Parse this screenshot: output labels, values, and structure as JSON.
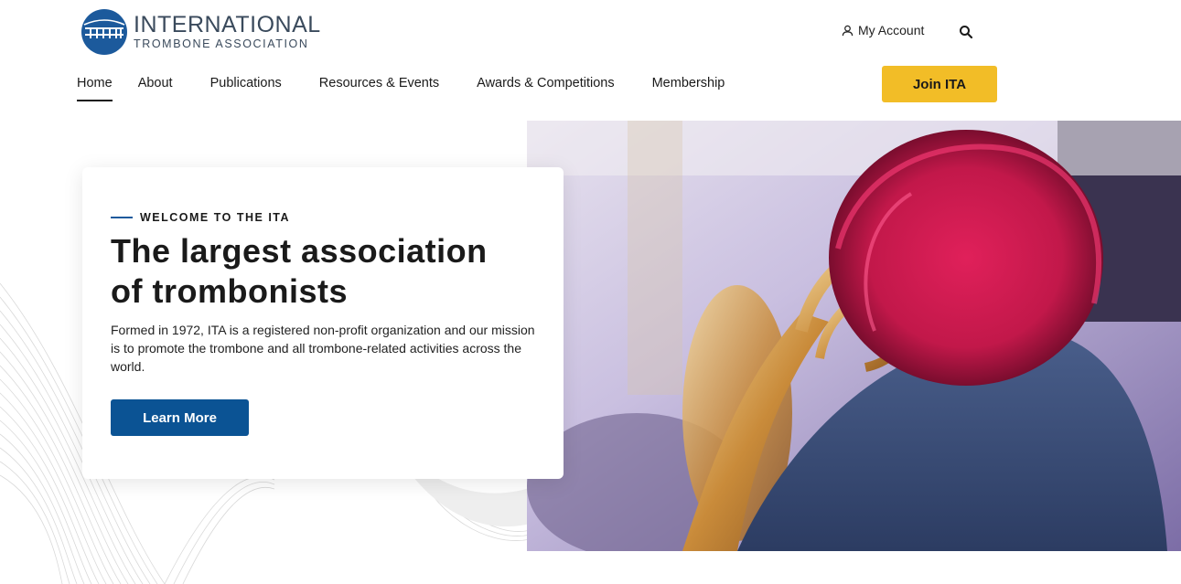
{
  "brand": {
    "line1": "INTERNATIONAL",
    "line2": "TROMBONE ASSOCIATION",
    "logo_mark_text": "ITA",
    "logo_icon": "ita-logo-icon",
    "color": "#1c5a9c"
  },
  "utility": {
    "account_label": "My Account",
    "account_icon": "user-icon",
    "search_icon": "search-icon"
  },
  "nav": {
    "items": [
      {
        "label": "Home",
        "active": true
      },
      {
        "label": "About"
      },
      {
        "label": "Publications"
      },
      {
        "label": "Resources & Events"
      },
      {
        "label": "Awards & Competitions"
      },
      {
        "label": "Membership"
      }
    ]
  },
  "join_label": "Join ITA",
  "hero": {
    "eyebrow": "WELCOME TO THE ITA",
    "headline_line1": "The largest association",
    "headline_line2": "of trombonists",
    "body": "Formed in 1972, ITA is a registered non-profit organization and our mission is to promote the trombone and all trombone-related activities across the world.",
    "cta": "Learn More",
    "image_icon": "trombonist-photo"
  },
  "colors": {
    "accent_blue": "#0b5394",
    "join_yellow": "#f2bd27",
    "text": "#1a1a1a"
  }
}
